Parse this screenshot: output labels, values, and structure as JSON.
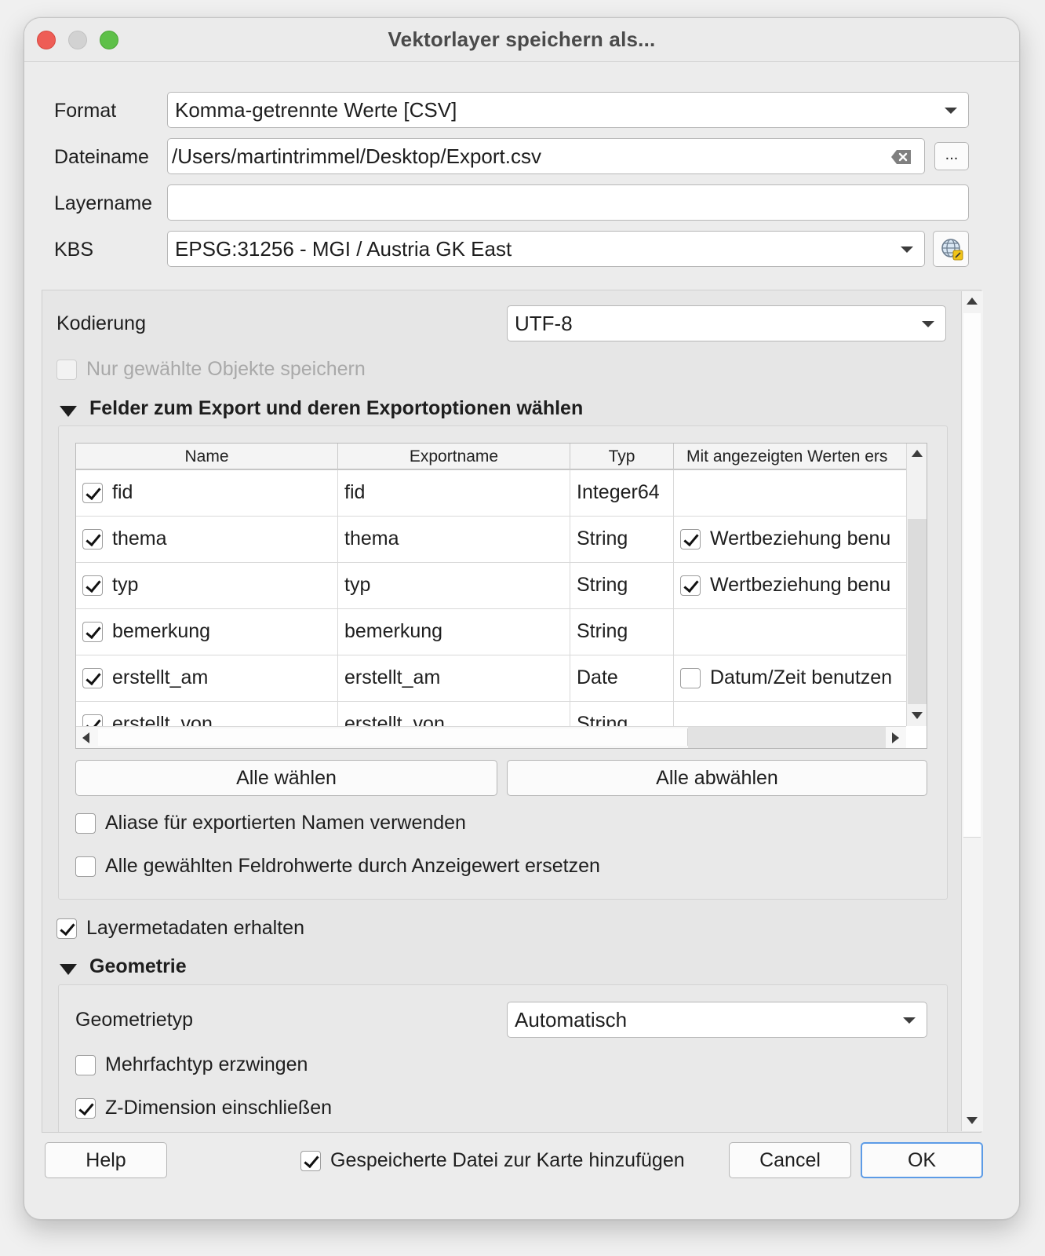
{
  "window": {
    "title": "Vektorlayer speichern als..."
  },
  "form": {
    "format_label": "Format",
    "format_value": "Komma-getrennte Werte [CSV]",
    "filename_label": "Dateiname",
    "filename_value": "/Users/martintrimmel/Desktop/Export.csv",
    "browse_label": "...",
    "layername_label": "Layername",
    "layername_value": "",
    "crs_label": "KBS",
    "crs_value": "EPSG:31256 - MGI / Austria GK East"
  },
  "options": {
    "encoding_label": "Kodierung",
    "encoding_value": "UTF-8",
    "selected_only_label": "Nur gewählte Objekte speichern",
    "selected_only_checked": false,
    "fields_section_title": "Felder zum Export und deren Exportoptionen wählen",
    "keep_metadata_label": "Layermetadaten erhalten",
    "keep_metadata_checked": true
  },
  "fields_table": {
    "columns": [
      "Name",
      "Exportname",
      "Typ",
      "Mit angezeigten Werten ers"
    ],
    "rows": [
      {
        "checked": true,
        "name": "fid",
        "exportname": "fid",
        "type": "Integer64",
        "display_checked": null,
        "display_label": ""
      },
      {
        "checked": true,
        "name": "thema",
        "exportname": "thema",
        "type": "String",
        "display_checked": true,
        "display_label": "Wertbeziehung benu"
      },
      {
        "checked": true,
        "name": "typ",
        "exportname": "typ",
        "type": "String",
        "display_checked": true,
        "display_label": "Wertbeziehung benu"
      },
      {
        "checked": true,
        "name": "bemerkung",
        "exportname": "bemerkung",
        "type": "String",
        "display_checked": null,
        "display_label": ""
      },
      {
        "checked": true,
        "name": "erstellt_am",
        "exportname": "erstellt_am",
        "type": "Date",
        "display_checked": false,
        "display_label": "Datum/Zeit benutzen"
      },
      {
        "checked": true,
        "name": "erstellt_von",
        "exportname": "erstellt_von",
        "type": "String",
        "display_checked": null,
        "display_label": ""
      }
    ],
    "select_all_label": "Alle wählen",
    "deselect_all_label": "Alle abwählen",
    "use_aliases_label": "Aliase für exportierten Namen verwenden",
    "use_aliases_checked": false,
    "replace_raw_label": "Alle gewählten Feldrohwerte durch Anzeigewert ersetzen",
    "replace_raw_checked": false
  },
  "geometry": {
    "section_title": "Geometrie",
    "type_label": "Geometrietyp",
    "type_value": "Automatisch",
    "force_multi_label": "Mehrfachtyp erzwingen",
    "force_multi_checked": false,
    "include_z_label": "Z-Dimension einschließen",
    "include_z_checked": true
  },
  "footer": {
    "help_label": "Help",
    "add_to_map_label": "Gespeicherte Datei zur Karte hinzufügen",
    "add_to_map_checked": true,
    "cancel_label": "Cancel",
    "ok_label": "OK"
  }
}
